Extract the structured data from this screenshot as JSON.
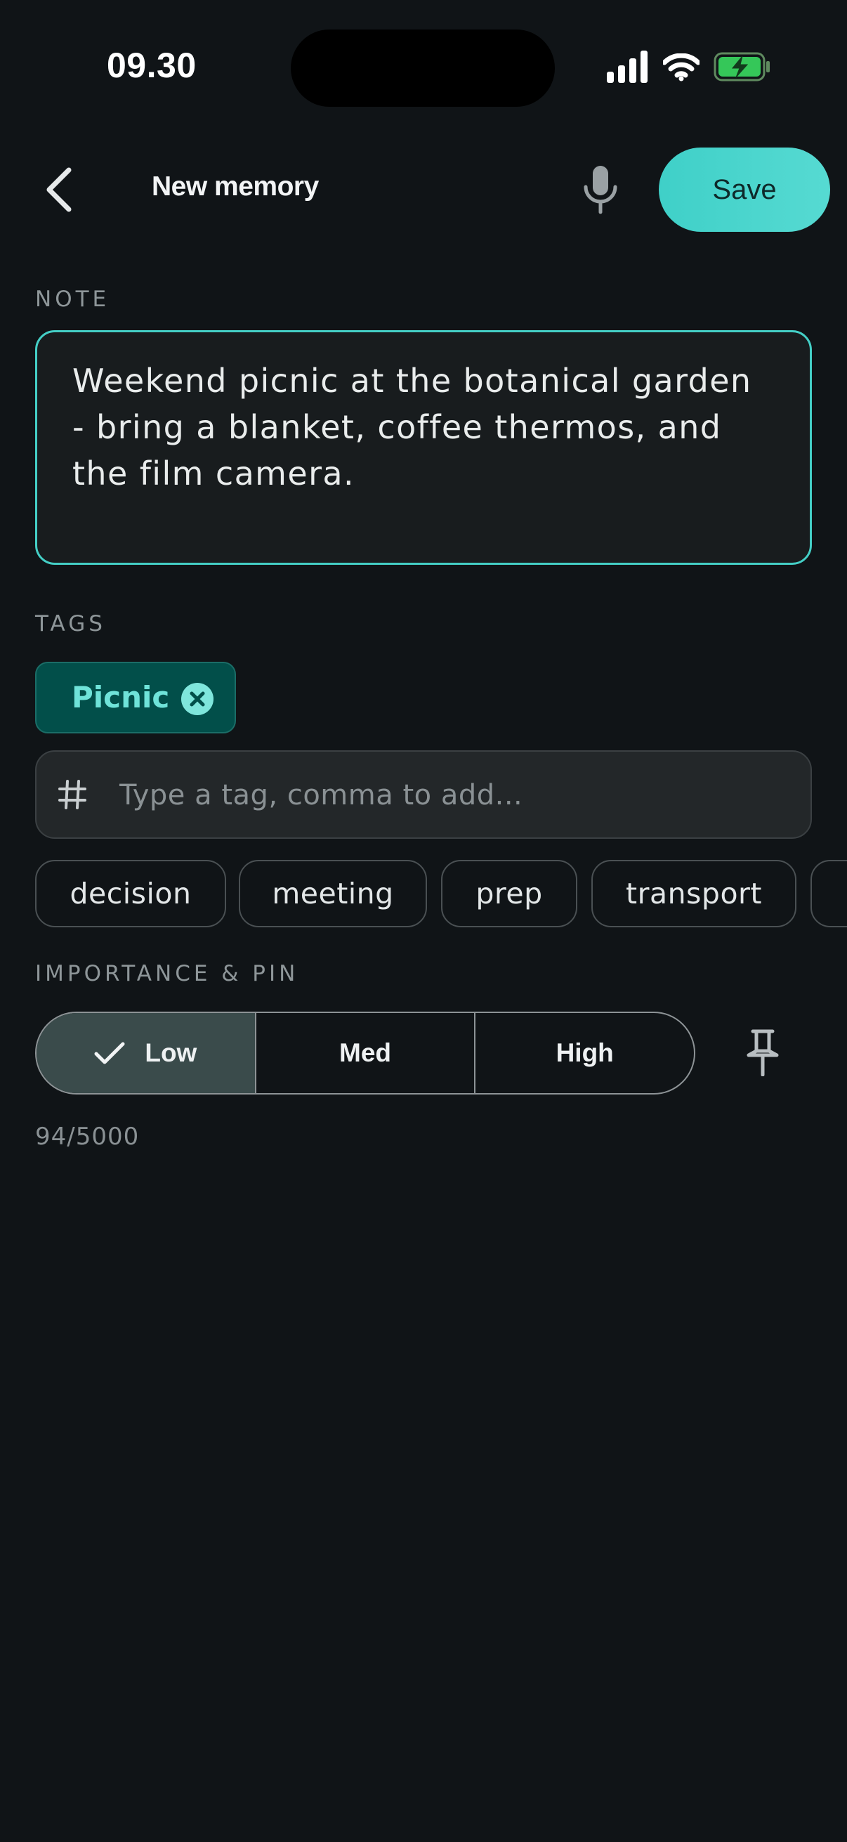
{
  "status_bar": {
    "time": "09.30"
  },
  "header": {
    "title": "New memory",
    "save_label": "Save"
  },
  "note": {
    "label": "NOTE",
    "value": "Weekend picnic at the botanical garden - bring a blanket, coffee thermos, and the film camera."
  },
  "tags": {
    "label": "TAGS",
    "selected": [
      "Picnic"
    ],
    "input_placeholder": "Type a tag, comma to add...",
    "suggestions": [
      "decision",
      "meeting",
      "prep",
      "transport"
    ]
  },
  "importance": {
    "label": "IMPORTANCE & PIN",
    "options": [
      "Low",
      "Med",
      "High"
    ],
    "selected": "Low"
  },
  "char_count": "94/5000",
  "colors": {
    "accent": "#44cfc6",
    "chip_bg": "#024f4a",
    "background": "#101417"
  }
}
